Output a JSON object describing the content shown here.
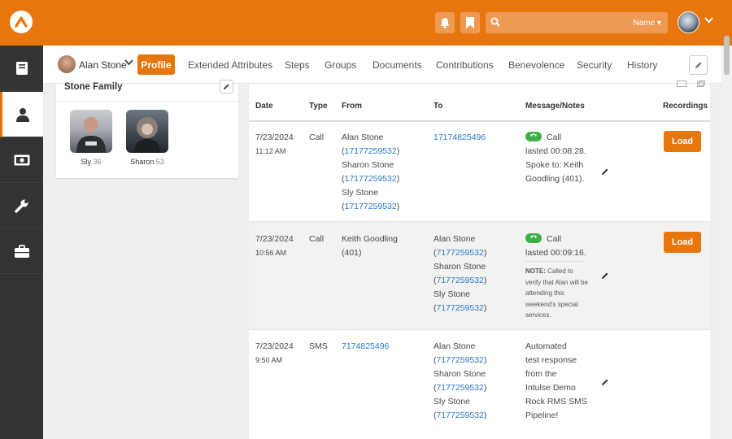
{
  "header": {
    "search_placeholder": "",
    "search_filter": "Name ▾"
  },
  "person": {
    "name": "Alan Stone"
  },
  "tabs": [
    {
      "label": "Profile",
      "active": true
    },
    {
      "label": "Extended Attributes"
    },
    {
      "label": "Steps"
    },
    {
      "label": "Groups"
    },
    {
      "label": "Documents"
    },
    {
      "label": "Contributions"
    },
    {
      "label": "Benevolence"
    },
    {
      "label": "Security"
    },
    {
      "label": "History"
    }
  ],
  "family": {
    "title": "Stone Family",
    "members": [
      {
        "name": "Sly",
        "age": "36"
      },
      {
        "name": "Sharon",
        "age": "53"
      }
    ]
  },
  "table": {
    "headers": [
      "Date",
      "Type",
      "From",
      "To",
      "Message/Notes",
      "Recordings"
    ],
    "rows": [
      {
        "date": "7/23/2024",
        "time": "11:12 AM",
        "type": "Call",
        "from": [
          [
            "Alan Stone",
            "17177259532"
          ],
          [
            "Sharon Stone",
            "17177259532"
          ],
          [
            "Sly Stone",
            "17177259532"
          ]
        ],
        "to_number": "17174825496",
        "message_lines": [
          "Call",
          "lasted 00:08:28.",
          "Spoke to: Keith",
          "Goodling (401)."
        ],
        "load_label": "Load"
      },
      {
        "date": "7/23/2024",
        "time": "10:56 AM",
        "type": "Call",
        "from_text": [
          "Keith Goodling",
          "(401)"
        ],
        "to": [
          [
            "Alan Stone",
            "7177259532"
          ],
          [
            "Sharon Stone",
            "7177259532"
          ],
          [
            "Sly Stone",
            "7177259532"
          ]
        ],
        "message_lines": [
          "Call",
          "lasted 00:09:16."
        ],
        "note_label": "NOTE:",
        "note_text": "Called to verify that Alan will be attending this weekend's special services.",
        "load_label": "Load"
      },
      {
        "date": "7/23/2024",
        "time": "9:50 AM",
        "type": "SMS",
        "from_number": "7174825496",
        "to": [
          [
            "Alan Stone",
            "7177259532"
          ],
          [
            "Sharon Stone",
            "7177259532"
          ],
          [
            "Sly Stone",
            "7177259532"
          ]
        ],
        "message_lines": [
          "Automated",
          "test response",
          "from the",
          "Intulse Demo",
          "Rock RMS SMS",
          "Pipeline!"
        ]
      }
    ]
  },
  "colors": {
    "brand": "#e7760f",
    "sidebar": "#333333",
    "link": "#2a78c7",
    "call_badge": "#3fae49"
  }
}
